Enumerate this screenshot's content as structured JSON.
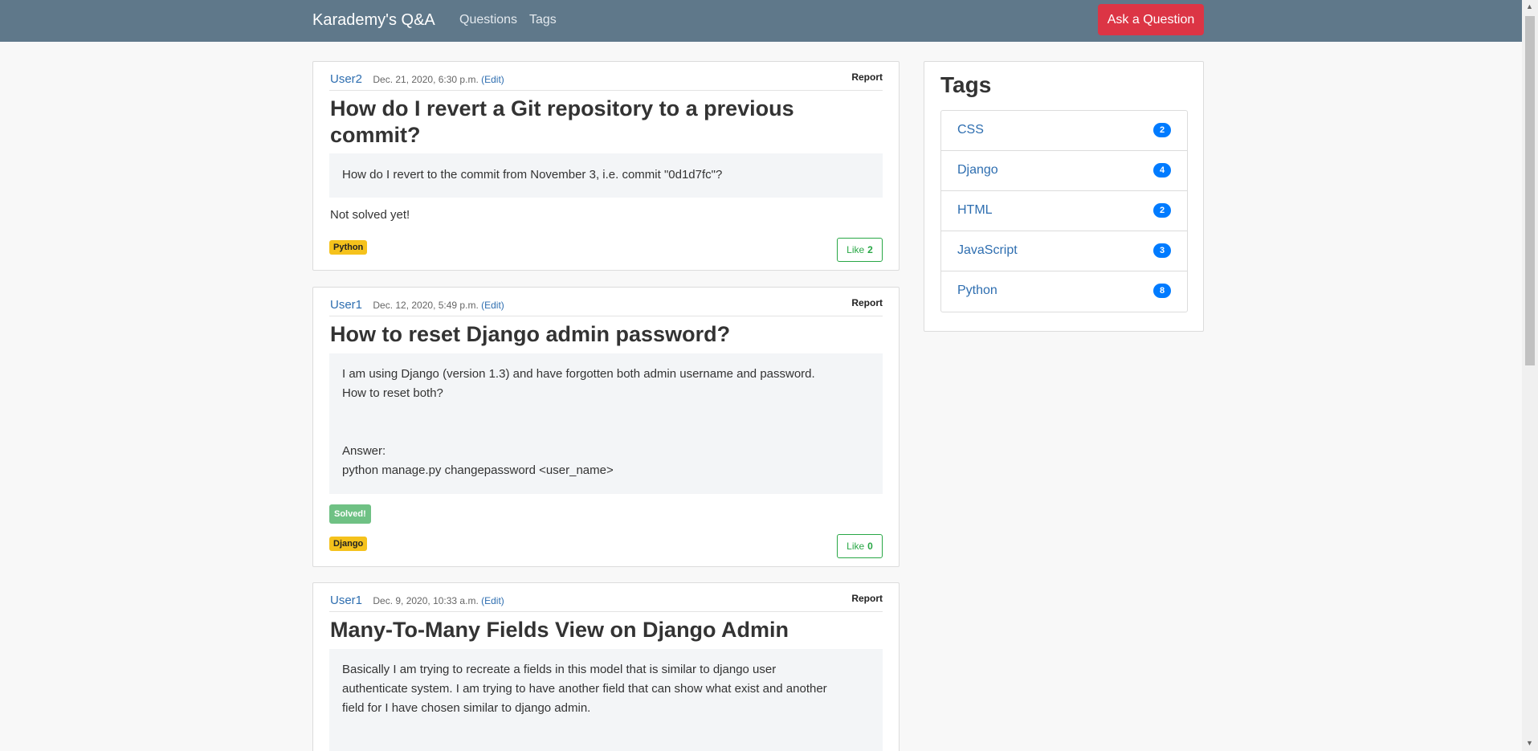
{
  "nav": {
    "brand": "Karademy's Q&A",
    "links": [
      "Questions",
      "Tags"
    ],
    "ask_button": "Ask a Question"
  },
  "questions": [
    {
      "user": "User2",
      "date": "Dec. 21, 2020, 6:30 p.m.",
      "edit": "(Edit)",
      "report": "Report",
      "title": "How do I revert a Git repository to a previous commit?",
      "body": "How do I revert to the commit from November 3, i.e. commit \"0d1d7fc\"?",
      "status": "Not solved yet!",
      "tag": "Python",
      "like_label": "Like",
      "likes": "2"
    },
    {
      "user": "User1",
      "date": "Dec. 12, 2020, 5:49 p.m.",
      "edit": "(Edit)",
      "report": "Report",
      "title": "How to reset Django admin password?",
      "body": "I am using Django (version 1.3) and have forgotten both admin username and password.\nHow to reset both?\n\n\nAnswer:\npython manage.py changepassword <user_name>",
      "status": "Solved!",
      "tag": "Django",
      "like_label": "Like",
      "likes": "0"
    },
    {
      "user": "User1",
      "date": "Dec. 9, 2020, 10:33 a.m.",
      "edit": "(Edit)",
      "report": "Report",
      "title": "Many-To-Many Fields View on Django Admin",
      "body": "Basically I am trying to recreate a fields in this model that is similar to django user\nauthenticate system. I am trying to have another field that can show what exist and another\nfield for I have chosen similar to django admin."
    }
  ],
  "tags_panel": {
    "title": "Tags",
    "items": [
      {
        "name": "CSS",
        "count": "2"
      },
      {
        "name": "Django",
        "count": "4"
      },
      {
        "name": "HTML",
        "count": "2"
      },
      {
        "name": "JavaScript",
        "count": "3"
      },
      {
        "name": "Python",
        "count": "8"
      }
    ]
  },
  "colors": {
    "navbar": "#5f788a",
    "ask_button": "#dc3545",
    "tag_badge": "#f5c21c",
    "solved_badge": "#6fc184",
    "count_badge": "#007bff"
  }
}
